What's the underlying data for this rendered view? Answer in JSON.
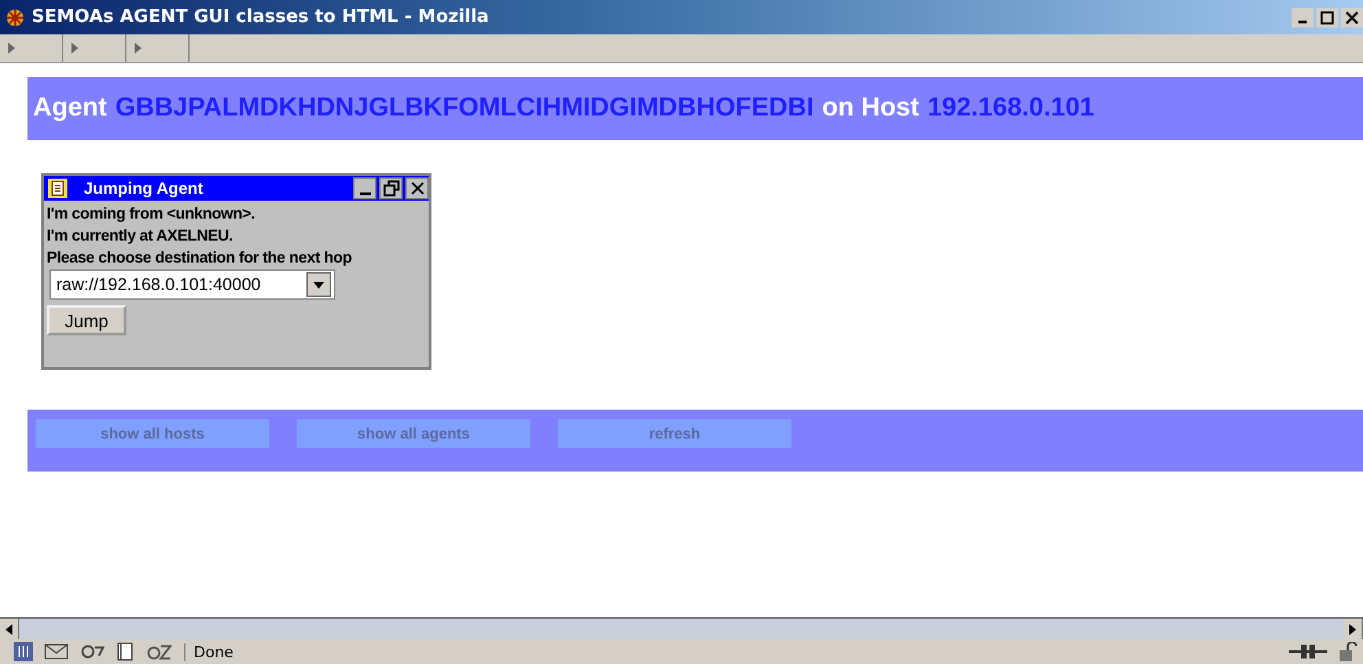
{
  "window": {
    "title": "SEMOAs AGENT GUI classes to HTML - Mozilla"
  },
  "banner": {
    "agent_label": "Agent",
    "agent_id": "GBBJPALMDKHDNJGLBKFOMLCIHMIDGIMDBHOFEDBI",
    "host_label": "on Host",
    "host": "192.168.0.101"
  },
  "dialog": {
    "title": "Jumping Agent",
    "lines": [
      "I'm coming from <unknown>.",
      "I'm currently at AXELNEU.",
      "Please choose destination for the next hop"
    ],
    "destination": "raw://192.168.0.101:40000",
    "button": "Jump"
  },
  "buttons": [
    "show all hosts",
    "show all agents",
    "refresh"
  ],
  "status_bar": {
    "text": "Done"
  }
}
